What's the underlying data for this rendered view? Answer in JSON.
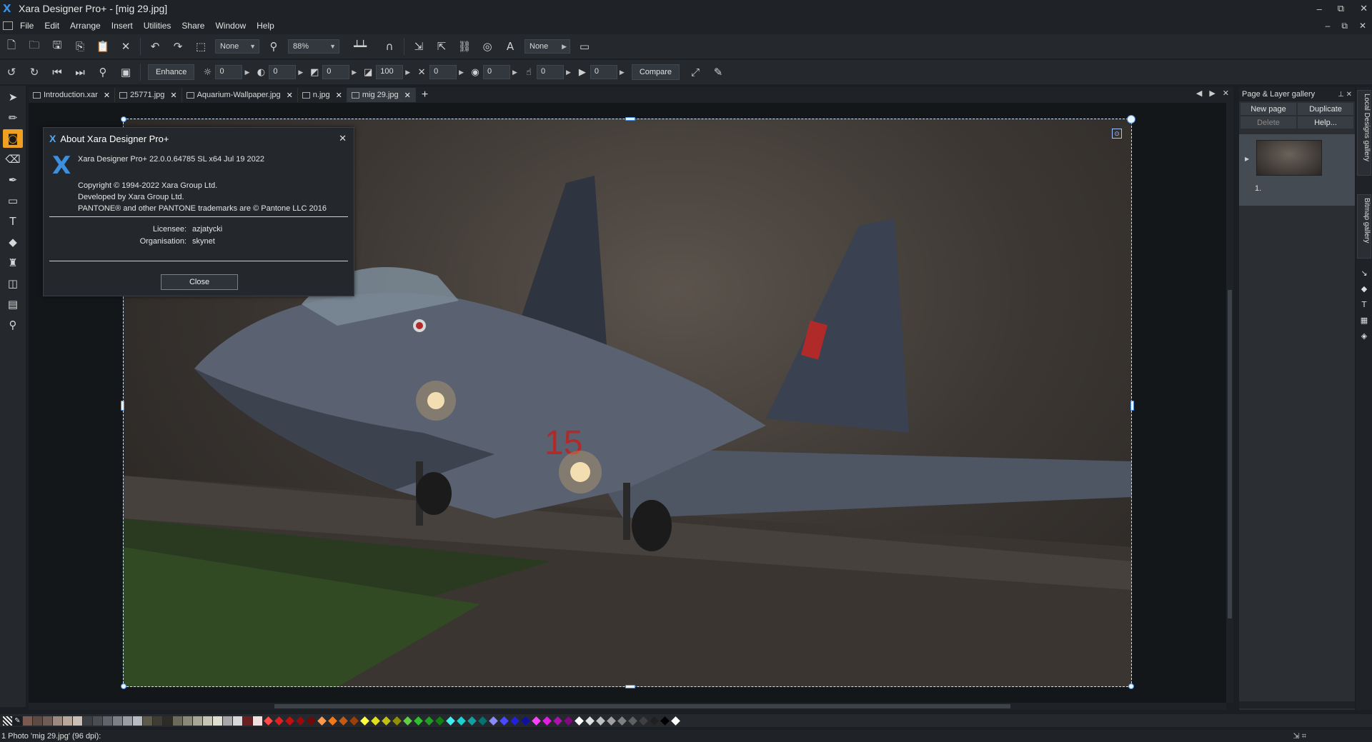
{
  "window": {
    "title": "Xara Designer Pro+ - [mig 29.jpg]",
    "controls": [
      "–",
      "⧉",
      "✕"
    ]
  },
  "menu": {
    "items": [
      "File",
      "Edit",
      "Arrange",
      "Insert",
      "Utilities",
      "Share",
      "Window",
      "Help"
    ],
    "doc_controls": [
      "–",
      "⧉",
      "✕"
    ]
  },
  "toolbar1": {
    "zoom_combo": "None",
    "zoom_value": "88%",
    "quality_combo": "None"
  },
  "toolbar2": {
    "enhance_label": "Enhance",
    "compare_label": "Compare",
    "adjustments": [
      {
        "icon": "brightness-icon",
        "glyph": "☼",
        "value": "0"
      },
      {
        "icon": "contrast-icon",
        "glyph": "◐",
        "value": "0"
      },
      {
        "icon": "tone-icon",
        "glyph": "◩",
        "value": "0"
      },
      {
        "icon": "saturation-icon",
        "glyph": "◪",
        "value": "100"
      },
      {
        "icon": "temperature-icon",
        "glyph": "✕",
        "value": "0"
      },
      {
        "icon": "blur-icon",
        "glyph": "◉",
        "value": "0"
      },
      {
        "icon": "sharpen-icon",
        "glyph": "☝",
        "value": "0"
      },
      {
        "icon": "vignette-icon",
        "glyph": "▶",
        "value": "0"
      }
    ]
  },
  "tabs": [
    {
      "label": "Introduction.xar",
      "active": false
    },
    {
      "label": "25771.jpg",
      "active": false
    },
    {
      "label": "Aquarium-Wallpaper.jpg",
      "active": false
    },
    {
      "label": "n.jpg",
      "active": false
    },
    {
      "label": "mig 29.jpg",
      "active": true
    }
  ],
  "about_dialog": {
    "title": "About Xara Designer Pro+",
    "version_line": "Xara Designer Pro+ 22.0.0.64785  SL x64 Jul 19 2022",
    "copyright": "Copyright © 1994-2022 Xara Group Ltd.",
    "developer": "Developed by Xara Group Ltd.",
    "pantone": "PANTONE® and other PANTONE trademarks are © Pantone LLC 2016",
    "licensee_label": "Licensee:",
    "licensee_value": "azjatycki",
    "organisation_label": "Organisation:",
    "organisation_value": "skynet",
    "close_label": "Close"
  },
  "gallery": {
    "title": "Page & Layer gallery",
    "new_page": "New  page",
    "duplicate": "Duplicate",
    "delete": "Delete",
    "help": "Help...",
    "page_number": "1."
  },
  "side_tabs": {
    "local_designs": "Local Designs gallery",
    "bitmap": "Bitmap gallery"
  },
  "status": {
    "text": "1 Photo 'mig 29.jpg' (96 dpi):"
  },
  "colors": {
    "accent": "#f0a020",
    "brand": "#3c8fe0",
    "greys": [
      "#7a5a4e",
      "#5c4a44",
      "#6e5c56",
      "#9c8a82",
      "#b9a79c",
      "#c9bfb6",
      "#3c3f44",
      "#4a4d52",
      "#60636a",
      "#7c7f86",
      "#9a9da4",
      "#b8bbc2",
      "#5e5a4a",
      "#3f3c34",
      "#2e2c26",
      "#6c6a5a",
      "#8a8878",
      "#a8a696",
      "#c6c4b4",
      "#e0ded0",
      "#a7a7a7",
      "#d8d8d8",
      "#6a2020",
      "#f0e0e0"
    ],
    "diamonds": [
      "#ff4a4a",
      "#e02020",
      "#c01010",
      "#9a0a0a",
      "#700808",
      "#ff9a4a",
      "#f07a1a",
      "#c85a10",
      "#9a4008",
      "#ffff40",
      "#e0e020",
      "#c0c010",
      "#909008",
      "#60d040",
      "#30c030",
      "#20a020",
      "#108010",
      "#40f0f0",
      "#20d0d0",
      "#10a0a0",
      "#087070",
      "#8a8aff",
      "#4a4aff",
      "#2020e0",
      "#1010a0",
      "#ff40ff",
      "#e020e0",
      "#b010b0",
      "#800880",
      "#ffffff",
      "#e0e0e0",
      "#c0c0c0",
      "#a0a0a0",
      "#808080",
      "#606060",
      "#404040",
      "#202020",
      "#000000",
      "#ffffff"
    ]
  }
}
